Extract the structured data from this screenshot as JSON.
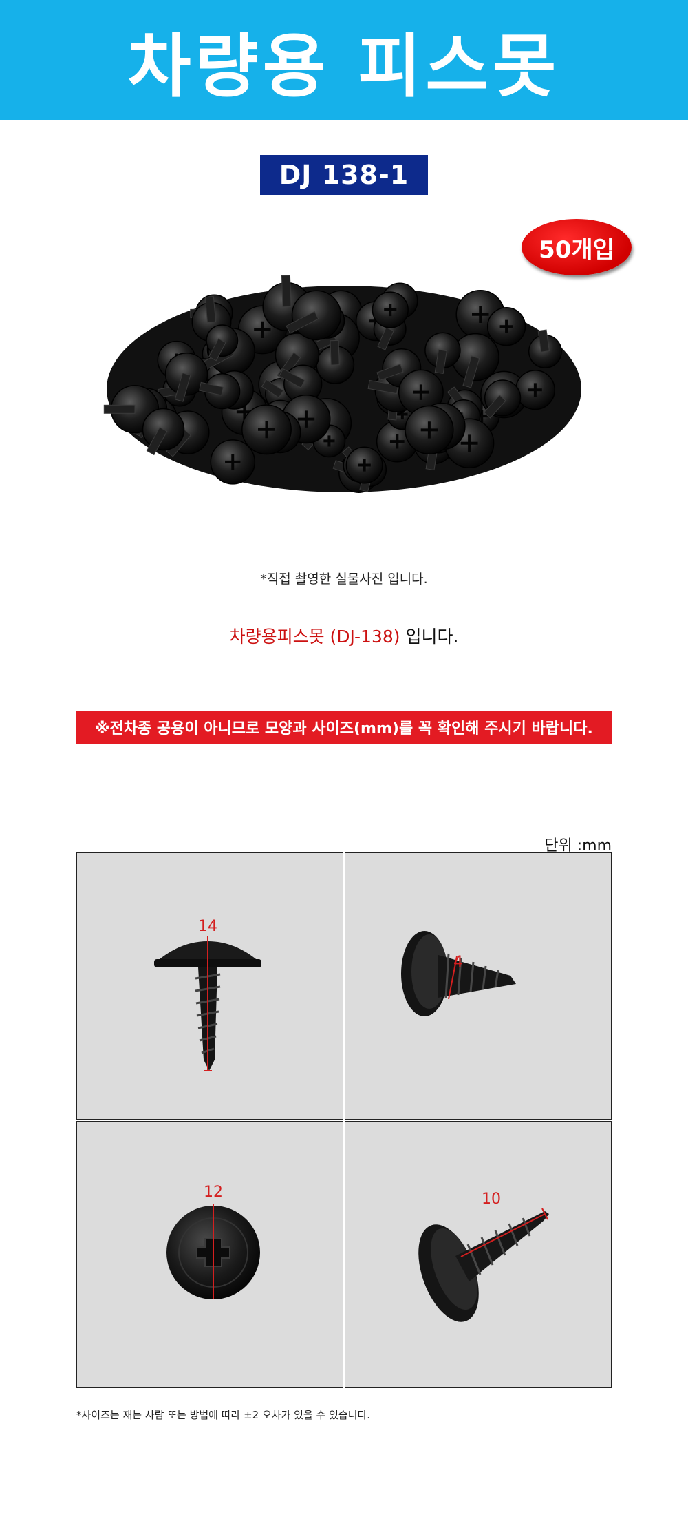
{
  "header": {
    "title": "차량용 피스못"
  },
  "product": {
    "model": "DJ 138-1",
    "quantity_badge": "50개입",
    "photo_note": "*직접 촬영한 실물사진 입니다.",
    "desc_red": "차량용피스못 (DJ-138)",
    "desc_black": " 입니다."
  },
  "warning": {
    "text": "※전차종 공용이 아니므로 모양과 사이즈(mm)를 꼭 확인해 주시기 바랍니다."
  },
  "dimensions": {
    "unit_label": "단위 :mm",
    "panels": [
      {
        "label": "14"
      },
      {
        "label": "4"
      },
      {
        "label": "12"
      },
      {
        "label": "10"
      }
    ]
  },
  "footer": {
    "note": "*사이즈는 재는 사람 또는 방법에 따라 ±2 오차가 있을 수 있습니다."
  },
  "colors": {
    "banner": "#16b1ea",
    "model_badge": "#0d2a8c",
    "accent_red": "#e31b23",
    "dimension_line": "#d41f1f"
  }
}
